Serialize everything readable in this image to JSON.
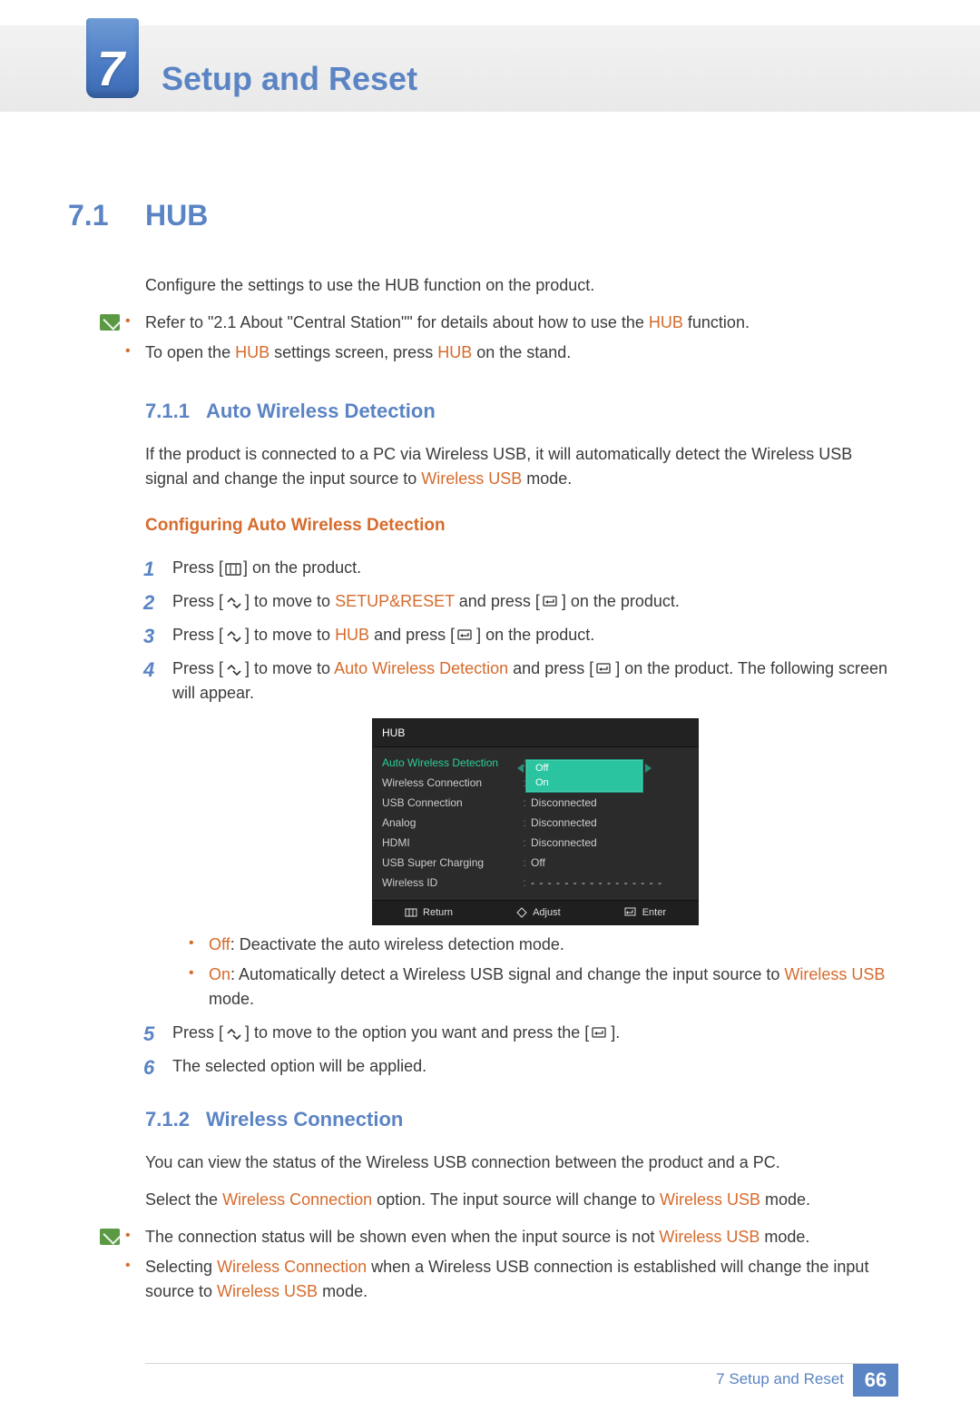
{
  "chapter": {
    "number": "7",
    "title": "Setup and Reset"
  },
  "section": {
    "number": "7.1",
    "title": "HUB",
    "intro": "Configure the settings to use the HUB function on the product.",
    "note1_a_pre": "Refer to \"2.1 About \"Central Station\"\" for details about how to use the ",
    "note1_a_hub": "HUB",
    "note1_a_post": " function.",
    "note1_b_pre": "To open the ",
    "note1_b_hub1": "HUB",
    "note1_b_mid": " settings screen, press ",
    "note1_b_hub2": "HUB",
    "note1_b_post": " on the stand."
  },
  "s711": {
    "num": "7.1.1",
    "title": "Auto Wireless Detection",
    "desc_pre": "If the product is connected to a PC via Wireless USB, it will automatically detect the Wireless USB signal and change the input source to ",
    "desc_link": "Wireless USB",
    "desc_post": " mode.",
    "config_heading": "Configuring Auto Wireless Detection",
    "step1": "Press [",
    "step1_post": "] on the product.",
    "step2_pre": "Press [",
    "step2_mid1": "] to move to ",
    "step2_link": "SETUP&RESET",
    "step2_mid2": " and press [",
    "step2_post": "] on the product.",
    "step3_pre": "Press [",
    "step3_mid1": "] to move to ",
    "step3_link": "HUB",
    "step3_mid2": " and press [",
    "step3_post": "] on the product.",
    "step4_pre": "Press [",
    "step4_mid1": "] to move to ",
    "step4_link": "Auto Wireless Detection",
    "step4_mid2": " and press [",
    "step4_post": "] on the product. The following screen will appear.",
    "off_label": "Off",
    "off_desc": ": Deactivate the auto wireless detection mode.",
    "on_label": "On",
    "on_desc_pre": ": Automatically detect a Wireless USB signal and change the input source to ",
    "on_desc_link": "Wireless USB",
    "on_desc_post": " mode.",
    "step5_pre": "Press [",
    "step5_mid": "] to move to the option you want and press the [",
    "step5_post": "].",
    "step6": "The selected option will be applied."
  },
  "osd": {
    "title": "HUB",
    "rows": [
      {
        "label": "Auto Wireless Detection",
        "selected": true,
        "opts": [
          "Off",
          "On"
        ]
      },
      {
        "label": "Wireless Connection",
        "value": ""
      },
      {
        "label": "USB Connection",
        "value": "Disconnected"
      },
      {
        "label": "Analog",
        "value": "Disconnected"
      },
      {
        "label": "HDMI",
        "value": "Disconnected"
      },
      {
        "label": "USB Super Charging",
        "value": "Off"
      },
      {
        "label": "Wireless ID",
        "value": "- - - - - - - - - - - - - - - -"
      }
    ],
    "footer": {
      "return": "Return",
      "adjust": "Adjust",
      "enter": "Enter"
    }
  },
  "s712": {
    "num": "7.1.2",
    "title": "Wireless Connection",
    "p1": "You can view the status of the Wireless USB connection between the product and a PC.",
    "p2_pre": "Select the ",
    "p2_link": "Wireless Connection",
    "p2_mid": " option. The input source will change to ",
    "p2_link2": "Wireless USB",
    "p2_post": " mode.",
    "note_a_pre": "The connection status will be shown even when the input source is not ",
    "note_a_link": "Wireless USB",
    "note_a_post": " mode.",
    "note_b_pre": "Selecting ",
    "note_b_link1": "Wireless Connection",
    "note_b_mid": " when a Wireless USB connection is established will change the input source to ",
    "note_b_link2": "Wireless USB",
    "note_b_post": " mode."
  },
  "footer": {
    "text": "7 Setup and Reset",
    "page": "66"
  }
}
